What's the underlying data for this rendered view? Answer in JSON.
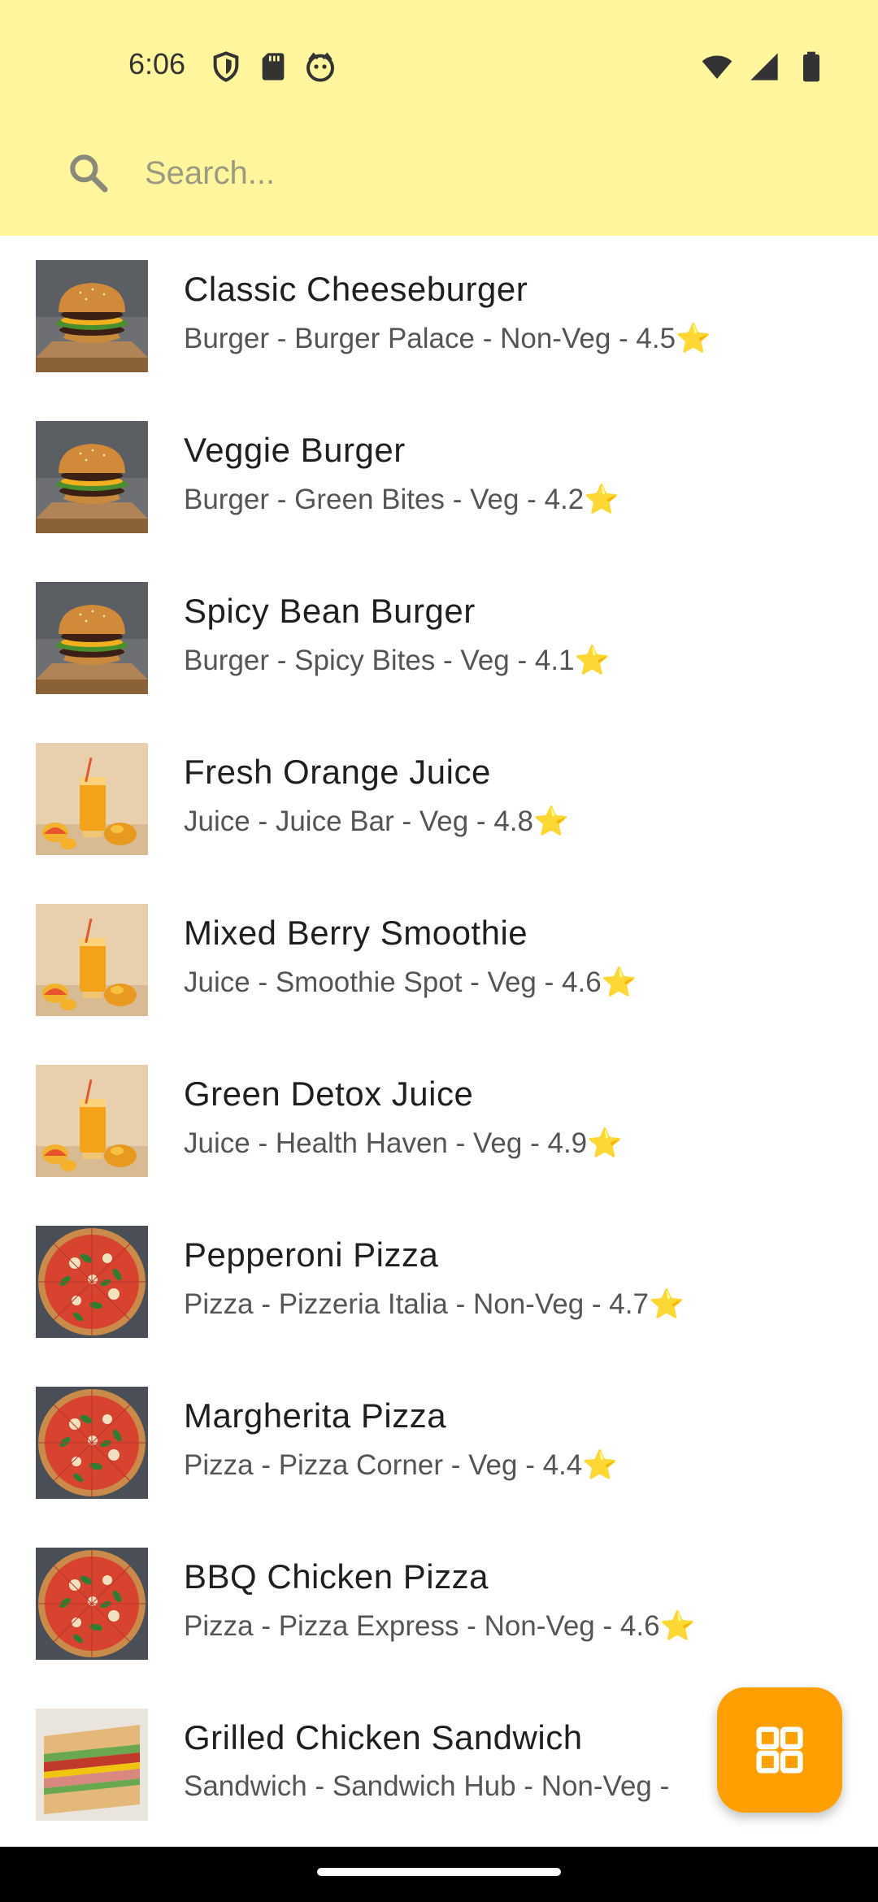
{
  "status": {
    "time": "6:06"
  },
  "search": {
    "placeholder": "Search..."
  },
  "items": [
    {
      "name": "Classic Cheeseburger",
      "category": "Burger",
      "restaurant": "Burger Palace",
      "type": "Non-Veg",
      "rating": "4.5",
      "image": "burger"
    },
    {
      "name": "Veggie Burger",
      "category": "Burger",
      "restaurant": "Green Bites",
      "type": "Veg",
      "rating": "4.2",
      "image": "burger"
    },
    {
      "name": "Spicy Bean Burger",
      "category": "Burger",
      "restaurant": "Spicy Bites",
      "type": "Veg",
      "rating": "4.1",
      "image": "burger"
    },
    {
      "name": "Fresh Orange Juice",
      "category": "Juice",
      "restaurant": "Juice Bar",
      "type": "Veg",
      "rating": "4.8",
      "image": "juice"
    },
    {
      "name": "Mixed Berry Smoothie",
      "category": "Juice",
      "restaurant": "Smoothie Spot",
      "type": "Veg",
      "rating": "4.6",
      "image": "juice"
    },
    {
      "name": "Green Detox Juice",
      "category": "Juice",
      "restaurant": "Health Haven",
      "type": "Veg",
      "rating": "4.9",
      "image": "juice"
    },
    {
      "name": "Pepperoni Pizza",
      "category": "Pizza",
      "restaurant": "Pizzeria Italia",
      "type": "Non-Veg",
      "rating": "4.7",
      "image": "pizza"
    },
    {
      "name": "Margherita Pizza",
      "category": "Pizza",
      "restaurant": "Pizza Corner",
      "type": "Veg",
      "rating": "4.4",
      "image": "pizza"
    },
    {
      "name": "BBQ Chicken Pizza",
      "category": "Pizza",
      "restaurant": "Pizza Express",
      "type": "Non-Veg",
      "rating": "4.6",
      "image": "pizza"
    },
    {
      "name": "Grilled Chicken Sandwich",
      "category": "Sandwich",
      "restaurant": "Sandwich Hub",
      "type": "Non-Veg",
      "rating": "",
      "image": "sandwich"
    }
  ],
  "colors": {
    "header": "#fff59d",
    "fab": "#ffa000",
    "star": "#f5c518"
  },
  "fab": {
    "icon": "grid-icon"
  }
}
